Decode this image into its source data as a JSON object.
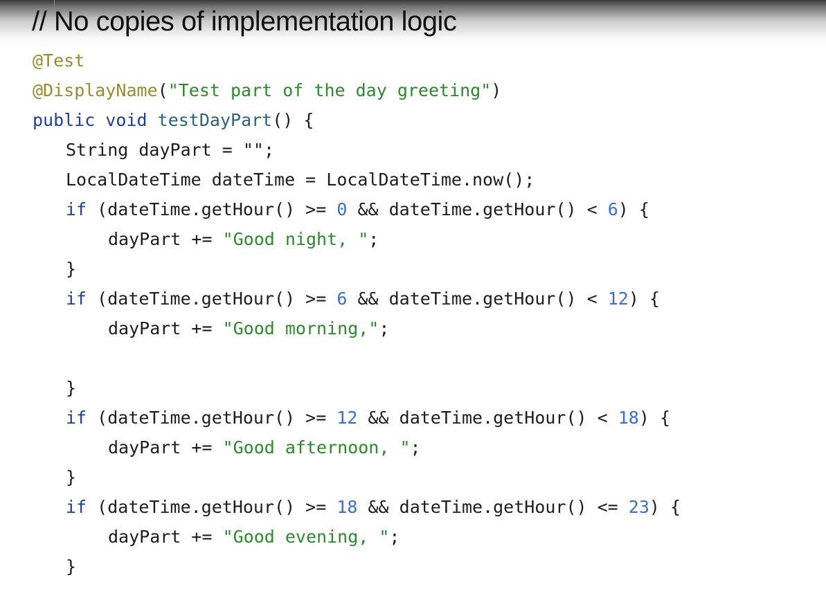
{
  "slide": {
    "title": "// No copies of implementation logic"
  },
  "code": {
    "annotation_test": "@Test",
    "annotation_display_name": "@DisplayName",
    "display_name_open": "(",
    "display_name_string": "\"Test part of the day greeting\"",
    "display_name_close": ")",
    "method_signature": {
      "public": "public",
      "void": "void",
      "name": "testDayPart",
      "rest": "() {"
    },
    "line_string_decl": "String dayPart = \"\";",
    "line_datetime_decl": "LocalDateTime dateTime = LocalDateTime.now();",
    "blocks": [
      {
        "if_kw": "if",
        "cond_a": " (dateTime.getHour() >= ",
        "low": "0",
        "cond_b": " && dateTime.getHour() < ",
        "high": "6",
        "cond_c": ") {",
        "body_prefix": "dayPart += ",
        "body_string": "\"Good night, \"",
        "body_suffix": ";",
        "close": "}"
      },
      {
        "if_kw": "if",
        "cond_a": " (dateTime.getHour() >= ",
        "low": "6",
        "cond_b": " && dateTime.getHour() < ",
        "high": "12",
        "cond_c": ") {",
        "body_prefix": "dayPart += ",
        "body_string": "\"Good morning,\"",
        "body_suffix": ";",
        "close": "}"
      },
      {
        "if_kw": "if",
        "cond_a": " (dateTime.getHour() >= ",
        "low": "12",
        "cond_b": " && dateTime.getHour() < ",
        "high": "18",
        "cond_c": ") {",
        "body_prefix": "dayPart += ",
        "body_string": "\"Good afternoon, \"",
        "body_suffix": ";",
        "close": "}"
      },
      {
        "if_kw": "if",
        "cond_a": " (dateTime.getHour() >= ",
        "low": "18",
        "cond_b": " && dateTime.getHour() <= ",
        "high": "23",
        "cond_c": ") {",
        "body_prefix": "dayPart += ",
        "body_string": "\"Good evening, \"",
        "body_suffix": ";",
        "close": "}"
      }
    ]
  },
  "colors": {
    "annotation": "#9a8a2a",
    "keyword": "#1f3d9e",
    "method_name": "#2a6478",
    "string": "#2b8a2b",
    "number": "#3a6fd0",
    "text": "#1d1d1d"
  }
}
